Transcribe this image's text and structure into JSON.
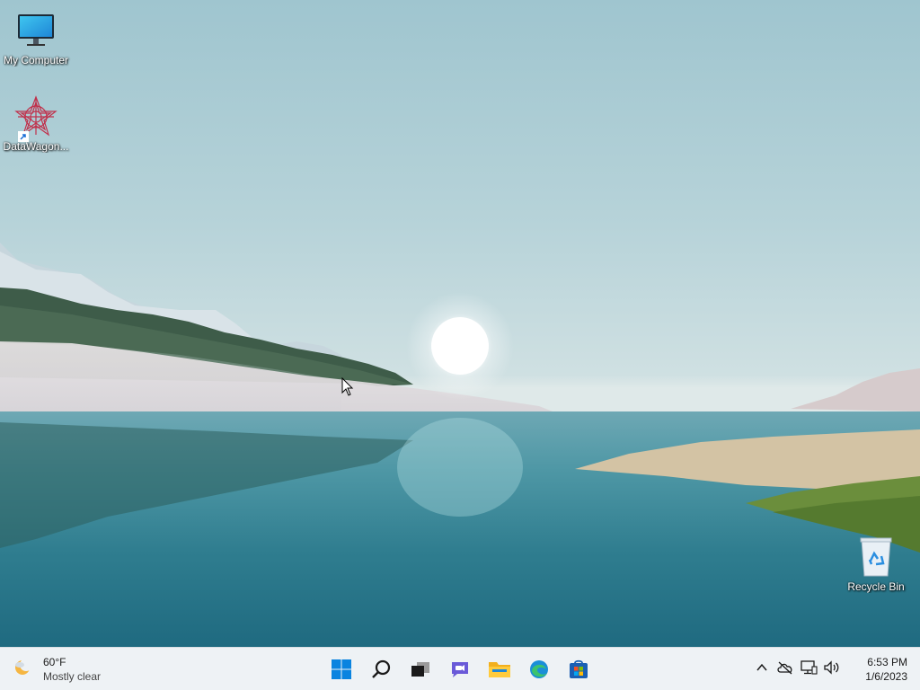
{
  "desktop": {
    "icons": [
      {
        "label": "My Computer",
        "icon": "monitor-icon"
      },
      {
        "label": "DataWagon...",
        "icon": "datawagon-icon"
      },
      {
        "label": "Recycle Bin",
        "icon": "recycle-bin-icon"
      }
    ]
  },
  "taskbar": {
    "weather": {
      "temp": "60°F",
      "condition": "Mostly clear",
      "icon": "moon-cloud-icon"
    },
    "apps": [
      {
        "name": "start",
        "icon": "windows-logo-icon"
      },
      {
        "name": "search",
        "icon": "search-icon"
      },
      {
        "name": "task-view",
        "icon": "task-view-icon"
      },
      {
        "name": "chat",
        "icon": "chat-icon"
      },
      {
        "name": "file-explorer",
        "icon": "folder-icon"
      },
      {
        "name": "edge",
        "icon": "edge-icon"
      },
      {
        "name": "store",
        "icon": "store-icon"
      }
    ],
    "tray": [
      "chevron-up-icon",
      "onedrive-offline-icon",
      "network-icon",
      "volume-icon"
    ],
    "clock": {
      "time": "6:53 PM",
      "date": "1/6/2023"
    }
  },
  "colors": {
    "sky": "#a9cad3",
    "water": "#3f8a98",
    "taskbar": "#eef2f5",
    "accent": "#0078d4"
  }
}
